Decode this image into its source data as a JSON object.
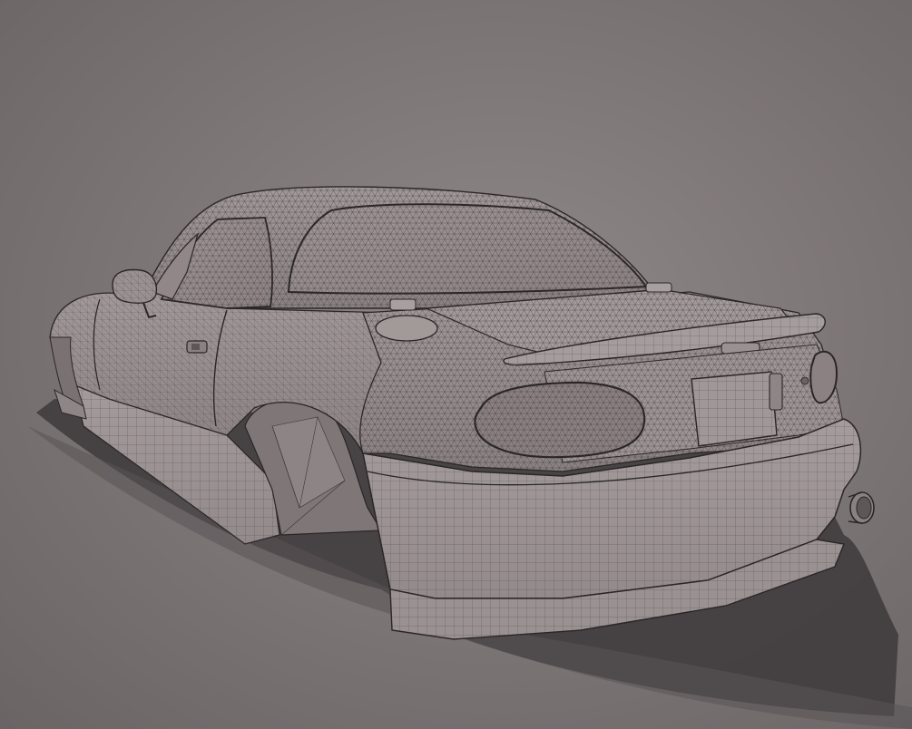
{
  "scene": {
    "subject": "car-wireframe-model",
    "render_mode": "wireframe-on-shaded",
    "colors": {
      "background_center": "#8f8889",
      "background_edge": "#6a6465",
      "floor": "#807a7b",
      "shadow": "#3d3839",
      "body": "#9a9192",
      "body_dark": "#7d7475",
      "glass": "#968c8d",
      "panel_light": "#a8a0a0",
      "tail_light": "#877d7e",
      "mesh": "#3a3536",
      "outline": "#2a2627"
    }
  }
}
